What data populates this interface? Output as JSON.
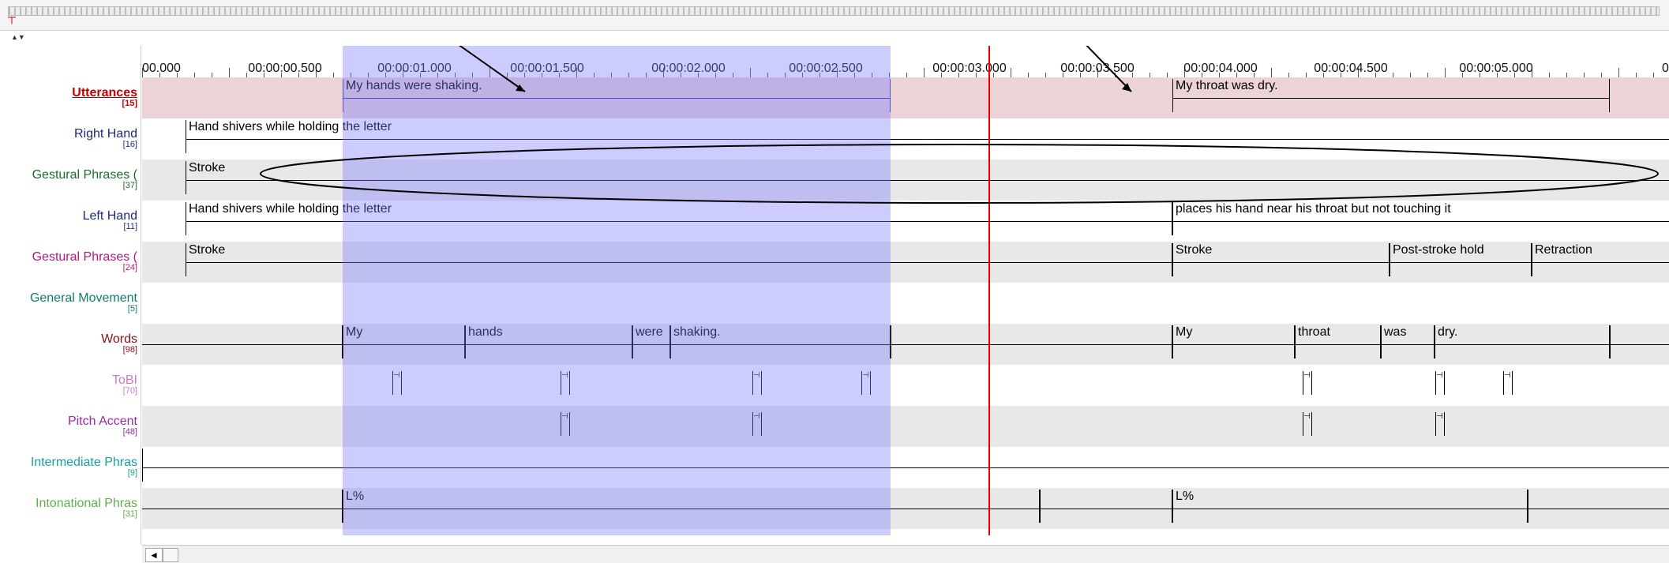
{
  "ruler": {
    "ticks": [
      "00.000",
      "00:00:00.500",
      "00:00:01.000",
      "00:00:01.500",
      "00:00:02.000",
      "00:00:02.500",
      "00:00:03.000",
      "00:00:03.500",
      "00:00:04.000",
      "00:00:04.500",
      "00:00:05.000",
      "0"
    ]
  },
  "tiers": [
    {
      "name": "Utterances",
      "count": "[15]",
      "color": "#c00000"
    },
    {
      "name": "Right Hand",
      "count": "[16]",
      "color": "#1f2a7a"
    },
    {
      "name": "Gestural Phrases (",
      "count": "[37]",
      "color": "#1d6b2a"
    },
    {
      "name": "Left Hand",
      "count": "[11]",
      "color": "#1f2a7a"
    },
    {
      "name": "Gestural Phrases (",
      "count": "[24]",
      "color": "#b01a78"
    },
    {
      "name": "General Movement",
      "count": "[5]",
      "color": "#127a74"
    },
    {
      "name": "Words",
      "count": "[98]",
      "color": "#8b0f1a"
    },
    {
      "name": "ToBI",
      "count": "[70]",
      "color": "#c87ac9"
    },
    {
      "name": "Pitch Accent",
      "count": "[48]",
      "color": "#9d2aa6"
    },
    {
      "name": "Intermediate Phras",
      "count": "[9]",
      "color": "#15a1a1"
    },
    {
      "name": "Intonational Phras",
      "count": "[31]",
      "color": "#5fae4f"
    }
  ],
  "annotations": {
    "utterance1": "My hands were shaking.",
    "utterance2": "My throat was dry.",
    "right_hand": "Hand shivers while holding the letter",
    "gesture1": "Stroke",
    "left_hand1": "Hand shivers while holding the letter",
    "left_hand2": "places his hand near his throat but not touching it",
    "gesture2_stroke1": "Stroke",
    "gesture2_stroke2": "Stroke",
    "gesture2_hold": "Post-stroke hold",
    "gesture2_retraction": "Retraction",
    "words": [
      "My",
      "hands",
      "were",
      "shaking.",
      "My",
      "throat",
      "was",
      "dry."
    ],
    "tone1": "L%",
    "tone2": "L%"
  },
  "colors": {
    "selection": "#7878ff",
    "cursor": "#e00000",
    "utterance_band": "#ecd3d6"
  },
  "icons": {
    "scroll_left": "◄",
    "marker": "┬"
  }
}
